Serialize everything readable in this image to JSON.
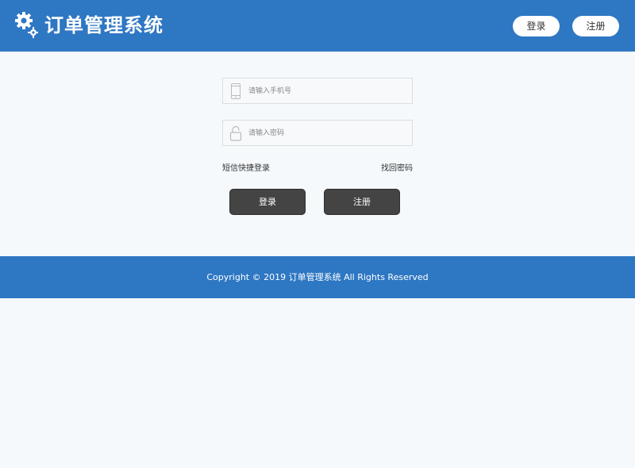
{
  "header": {
    "title": "订单管理系统",
    "logo_icon": "gears-icon",
    "login_label": "登录",
    "register_label": "注册"
  },
  "form": {
    "phone_placeholder": "请输入手机号",
    "phone_value": "",
    "phone_icon": "mobile-phone-icon",
    "password_placeholder": "请输入密码",
    "password_value": "",
    "password_icon": "unlock-icon",
    "sms_login_label": "短信快捷登录",
    "forgot_password_label": "找回密码",
    "login_button_label": "登录",
    "register_button_label": "注册"
  },
  "footer": {
    "copyright": "Copyright © 2019 订单管理系统 All Rights Reserved"
  },
  "colors": {
    "brand": "#2e77c3",
    "background": "#f5f9fc",
    "button_dark": "#444444"
  }
}
